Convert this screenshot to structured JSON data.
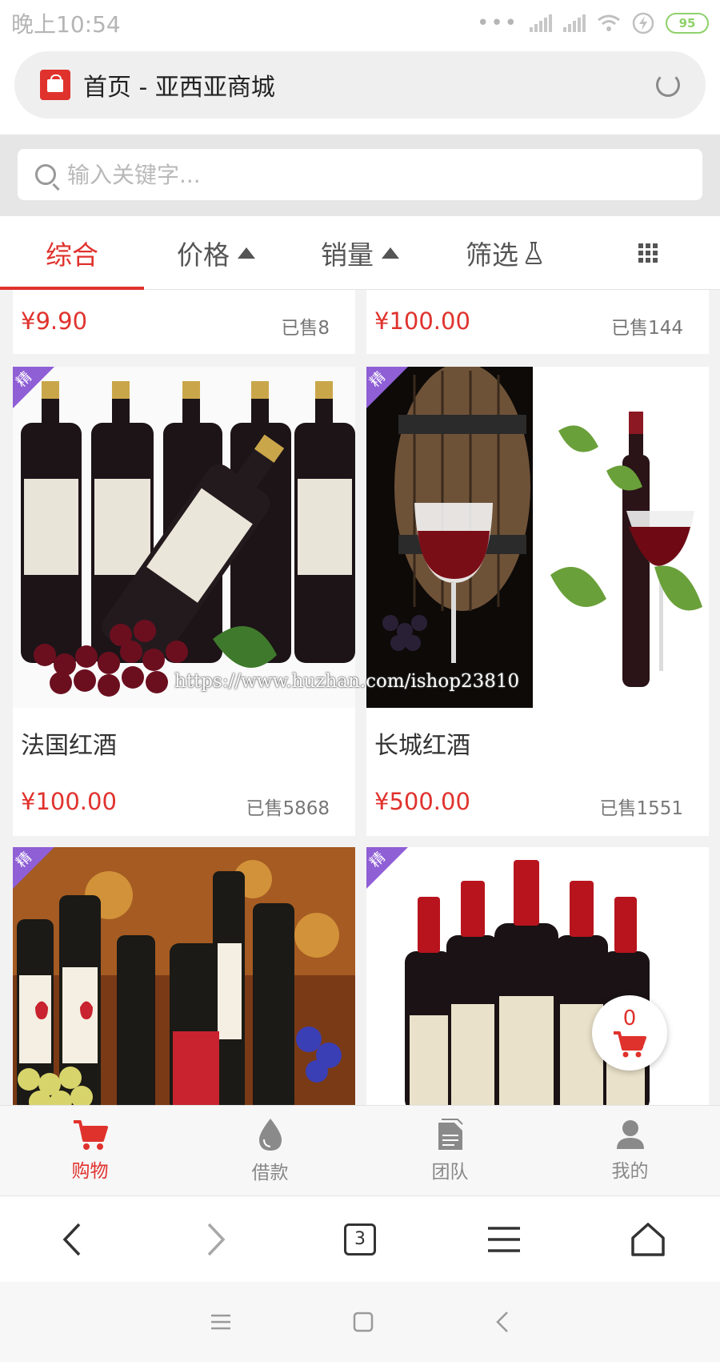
{
  "status_bar": {
    "time": "晚上10:54",
    "battery": "95"
  },
  "url_bar": {
    "title": "首页 - 亚西亚商城"
  },
  "search": {
    "placeholder": "输入关键字..."
  },
  "sort_tabs": [
    {
      "label": "综合",
      "active": true
    },
    {
      "label": "价格"
    },
    {
      "label": "销量"
    },
    {
      "label": "筛选"
    }
  ],
  "products_top_row": [
    {
      "price": "¥9.90",
      "sold": "已售8"
    },
    {
      "price": "¥100.00",
      "sold": "已售144"
    }
  ],
  "products": [
    {
      "name": "法国红酒",
      "price": "¥100.00",
      "sold": "已售5868",
      "badge": "精"
    },
    {
      "name": "长城红酒",
      "price": "¥500.00",
      "sold": "已售1551",
      "badge": "精"
    },
    {
      "badge": "精"
    },
    {
      "badge": "精"
    }
  ],
  "watermark": "https://www.huzhan.com/ishop23810",
  "floating_cart": {
    "count": "0"
  },
  "app_nav": [
    {
      "label": "购物",
      "icon": "cart-icon",
      "active": true
    },
    {
      "label": "借款",
      "icon": "drop-icon"
    },
    {
      "label": "团队",
      "icon": "document-icon"
    },
    {
      "label": "我的",
      "icon": "user-icon"
    }
  ],
  "browser_bar": {
    "tab_count": "3"
  },
  "colors": {
    "accent": "#e0322d",
    "badge": "#8f5fd6"
  }
}
